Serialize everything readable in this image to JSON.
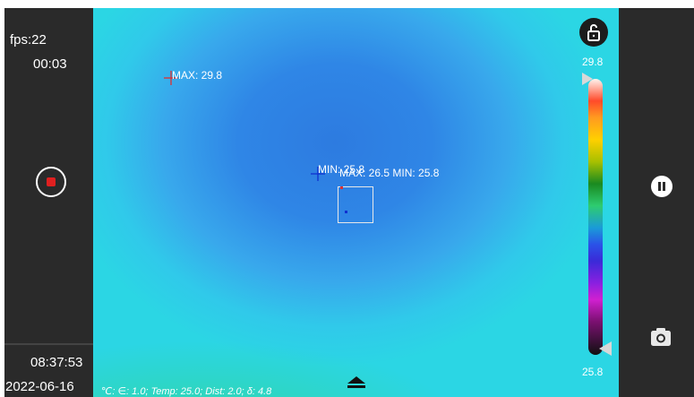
{
  "status_left": {
    "fps": "fps:22",
    "elapsed": "00:03",
    "clock": "08:37:53",
    "date": "2022-06-16"
  },
  "overlay": {
    "max_label": "MAX: 29.8",
    "min_label": "MIN: 25.8",
    "roi_label": "MAX: 26.5 MIN: 25.8",
    "params": "℃: ∈: 1.0; Temp: 25.0; Dist: 2.0; δ: 4.8"
  },
  "scale": {
    "max": "29.8",
    "min": "25.8"
  },
  "colors": {
    "panel": "#2a2a2a",
    "record": "#e02020",
    "max_marker": "#e03030",
    "min_marker": "#1030d0"
  },
  "icons": [
    "record-icon",
    "lock-icon",
    "pause-icon",
    "camera-icon",
    "eject-icon"
  ]
}
